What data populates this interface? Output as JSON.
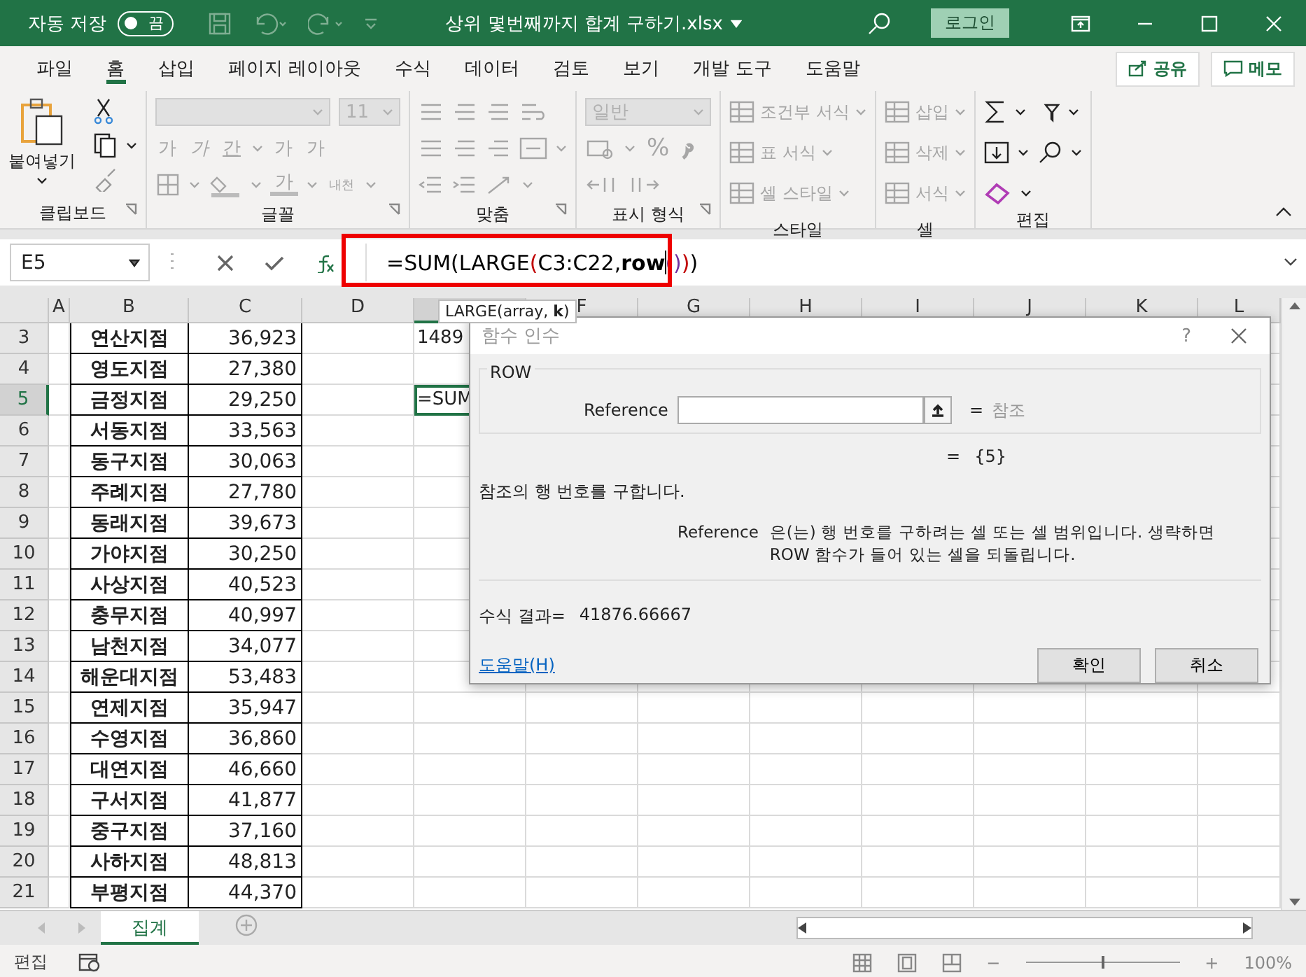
{
  "title_bar": {
    "autosave_label": "자동 저장",
    "autosave_toggle": {
      "label": "끔",
      "on": false
    },
    "file_name": "상위 몇번째까지 합계 구하기.xlsx",
    "login": "로그인"
  },
  "menu_tabs": [
    {
      "label": "파일",
      "selected": false
    },
    {
      "label": "홈",
      "selected": true
    },
    {
      "label": "삽입",
      "selected": false
    },
    {
      "label": "페이지 레이아웃",
      "selected": false
    },
    {
      "label": "수식",
      "selected": false
    },
    {
      "label": "데이터",
      "selected": false
    },
    {
      "label": "검토",
      "selected": false
    },
    {
      "label": "보기",
      "selected": false
    },
    {
      "label": "개발 도구",
      "selected": false
    },
    {
      "label": "도움말",
      "selected": false
    }
  ],
  "share_button": "공유",
  "memo_button": "메모",
  "ribbon": [
    {
      "kind": "clipboard",
      "label": "클립보드",
      "disabled": false,
      "paste": "붙여넣기"
    },
    {
      "kind": "font",
      "label": "글꼴",
      "disabled": true,
      "font_size": "11",
      "buttons": [
        "가",
        "가",
        "간",
        "가",
        "가"
      ],
      "font_color": "가",
      "phonetic": "내천"
    },
    {
      "kind": "alignment",
      "label": "맞춤",
      "disabled": true
    },
    {
      "kind": "number",
      "label": "표시 형식",
      "disabled": true,
      "format": "일반",
      "percent": "%"
    },
    {
      "kind": "styles",
      "label": "스타일",
      "disabled": true,
      "items": [
        "조건부 서식",
        "표 서식",
        "셀 스타일"
      ]
    },
    {
      "kind": "cells",
      "label": "셀",
      "disabled": true,
      "items": [
        "삽입",
        "삭제",
        "서식"
      ]
    },
    {
      "kind": "editing",
      "label": "편집",
      "disabled": false
    }
  ],
  "formula_bar": {
    "name_box": "E5",
    "formula": [
      {
        "text": "=SUM(LARGE",
        "color": "#000000",
        "bold": false
      },
      {
        "text": "(",
        "color": "#c00000",
        "bold": false
      },
      {
        "text": "C3:C22,",
        "color": "#000000",
        "bold": false
      },
      {
        "text": "row",
        "color": "#000000",
        "bold": true
      },
      {
        "text": "()",
        "color": "#7030a0",
        "bold": false
      },
      {
        "text": ")",
        "color": "#c00000",
        "bold": false
      },
      {
        "text": ")",
        "color": "#000000",
        "bold": false
      }
    ]
  },
  "tooltip": "LARGE(array, **k**)",
  "columns": [
    {
      "label": "A",
      "selected": false
    },
    {
      "label": "B",
      "selected": false
    },
    {
      "label": "C",
      "selected": false
    },
    {
      "label": "D",
      "selected": false
    },
    {
      "selected": true
    },
    {
      "label": "F",
      "selected": false
    },
    {
      "label": "G",
      "selected": false
    },
    {
      "label": "H",
      "selected": false
    },
    {
      "label": "I",
      "selected": false
    },
    {
      "label": "J",
      "selected": false
    },
    {
      "label": "K",
      "selected": false
    },
    {
      "label": "L",
      "selected": false
    }
  ],
  "rows": [
    {
      "label": "3",
      "selected": false,
      "b": "연산지점",
      "c": "36,923",
      "e": "1489"
    },
    {
      "label": "4",
      "selected": false,
      "b": "영도지점",
      "c": "27,380"
    },
    {
      "label": "5",
      "selected": true,
      "b": "금정지점",
      "c": "29,250",
      "e": "=SUM"
    },
    {
      "label": "6",
      "selected": false,
      "b": "서동지점",
      "c": "33,563"
    },
    {
      "label": "7",
      "selected": false,
      "b": "동구지점",
      "c": "30,063"
    },
    {
      "label": "8",
      "selected": false,
      "b": "주례지점",
      "c": "27,780"
    },
    {
      "label": "9",
      "selected": false,
      "b": "동래지점",
      "c": "39,673"
    },
    {
      "label": "10",
      "selected": false,
      "b": "가야지점",
      "c": "30,250"
    },
    {
      "label": "11",
      "selected": false,
      "b": "사상지점",
      "c": "40,523"
    },
    {
      "label": "12",
      "selected": false,
      "b": "충무지점",
      "c": "40,997"
    },
    {
      "label": "13",
      "selected": false,
      "b": "남천지점",
      "c": "34,077"
    },
    {
      "label": "14",
      "selected": false,
      "b": "해운대지점",
      "c": "53,483"
    },
    {
      "label": "15",
      "selected": false,
      "b": "연제지점",
      "c": "35,947"
    },
    {
      "label": "16",
      "selected": false,
      "b": "수영지점",
      "c": "36,860"
    },
    {
      "label": "17",
      "selected": false,
      "b": "대연지점",
      "c": "46,660"
    },
    {
      "label": "18",
      "selected": false,
      "b": "구서지점",
      "c": "41,877"
    },
    {
      "label": "19",
      "selected": false,
      "b": "중구지점",
      "c": "37,160"
    },
    {
      "label": "20",
      "selected": false,
      "b": "사하지점",
      "c": "48,813"
    },
    {
      "label": "21",
      "selected": false,
      "b": "부평지점",
      "c": "44,370"
    }
  ],
  "dialog": {
    "title": "함수 인수",
    "help": "?",
    "function_name": "ROW",
    "argument_label": "Reference",
    "argument_value_hint": "참조",
    "equals": "=",
    "result_preview": "{5}",
    "description": "참조의 행 번호를 구합니다.",
    "argument_help_label": "Reference",
    "argument_help": "은(는) 행 번호를 구하려는 셀 또는 셀 범위입니다. 생략하면 ROW 함수가 들어 있는 셀을 되돌립니다.",
    "formula_result_label": "수식 결과=",
    "formula_result": "41876.66667",
    "help_link": "도움말(H)",
    "ok_button": "확인",
    "cancel_button": "취소"
  },
  "sheet_tabs": [
    {
      "label": "집계",
      "selected": true
    }
  ],
  "status_bar": {
    "mode": "편집",
    "zoom_out": "−",
    "zoom_in": "+",
    "zoom": "100%",
    "zoom_level": {
      "level": 0.5
    }
  }
}
